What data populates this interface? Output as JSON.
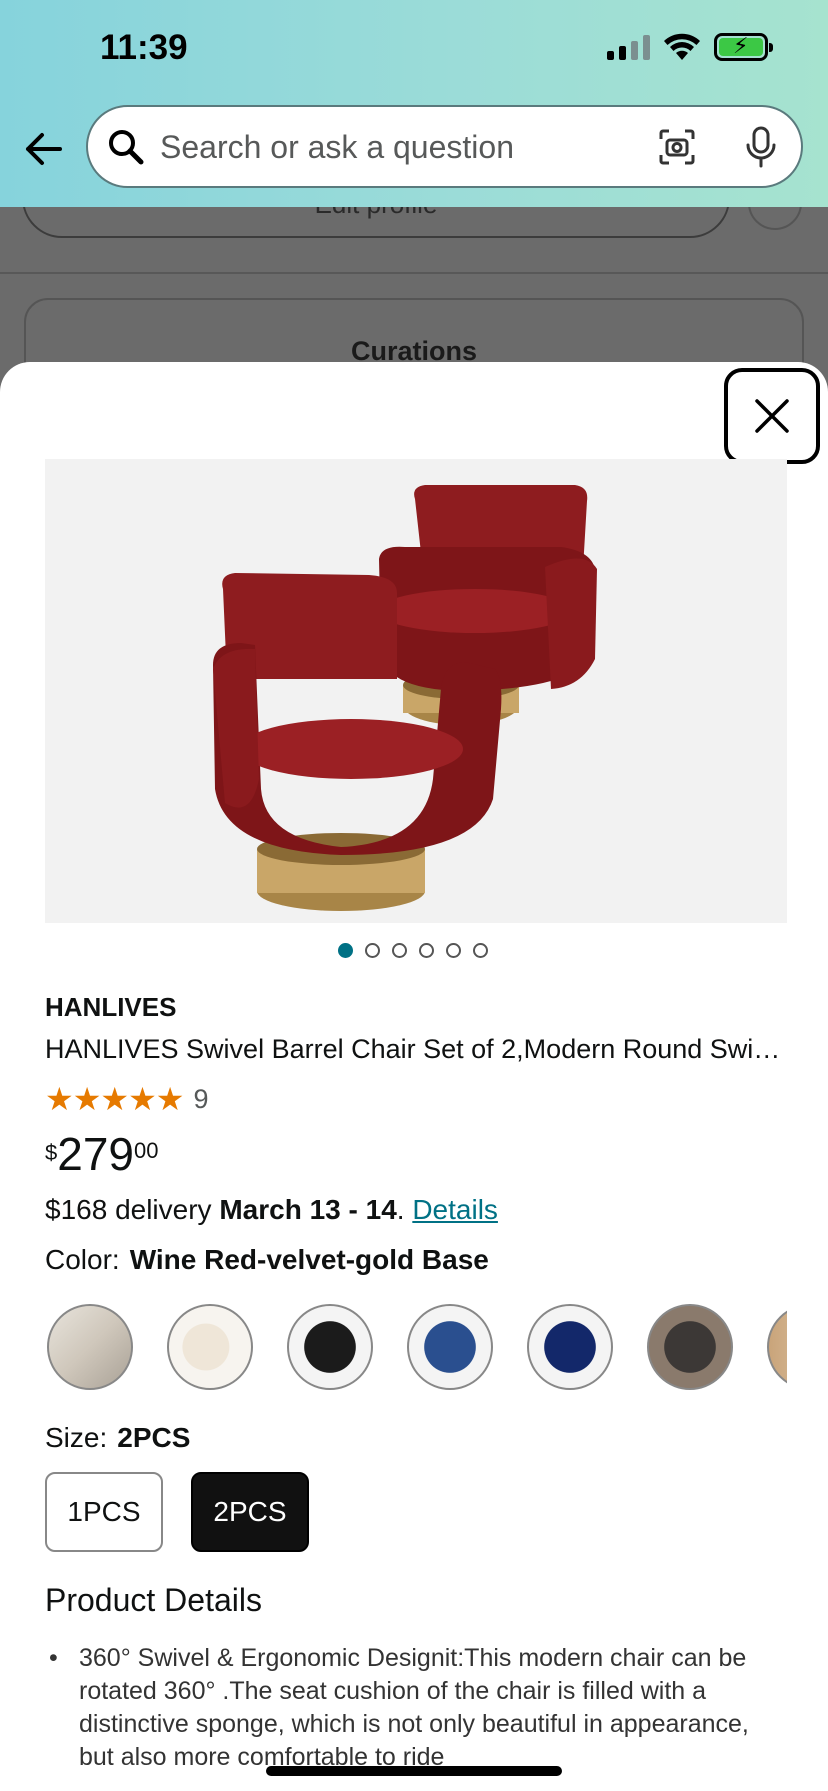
{
  "status_bar": {
    "time": "11:39"
  },
  "search": {
    "placeholder": "Search or ask a question"
  },
  "background_page": {
    "edit_label": "Edit profile",
    "card_title": "Curations"
  },
  "product": {
    "brand": "HANLIVES",
    "title": "HANLIVES Swivel Barrel Chair Set of 2,Modern Round Swi…",
    "stars": "★★★★★",
    "rating_count": "9",
    "price_symbol": "$",
    "price_whole": "279",
    "price_fraction": "00",
    "delivery_prefix": "$168 delivery ",
    "delivery_date": "March 13 - 14",
    "delivery_sep": ". ",
    "delivery_link": "Details",
    "color_label": "Color:",
    "color_value": "Wine Red-velvet-gold Base",
    "size_label": "Size:",
    "size_value": "2PCS",
    "size_options": [
      "1PCS",
      "2PCS"
    ],
    "selected_size": "2PCS",
    "image_count": 6,
    "image_index": 1,
    "details_heading": "Product Details",
    "bullet_1": "360° Swivel & Ergonomic Designit:This modern chair can be rotated 360° .The seat cushion of the chair is filled with a distinctive sponge, which is not only beautiful in appearance, but also more comfortable to ride"
  },
  "colors": {
    "accent_link": "#007185",
    "star": "#e67a00",
    "chair_red": "#8e1c1f",
    "gold_base": "#c9a668"
  }
}
